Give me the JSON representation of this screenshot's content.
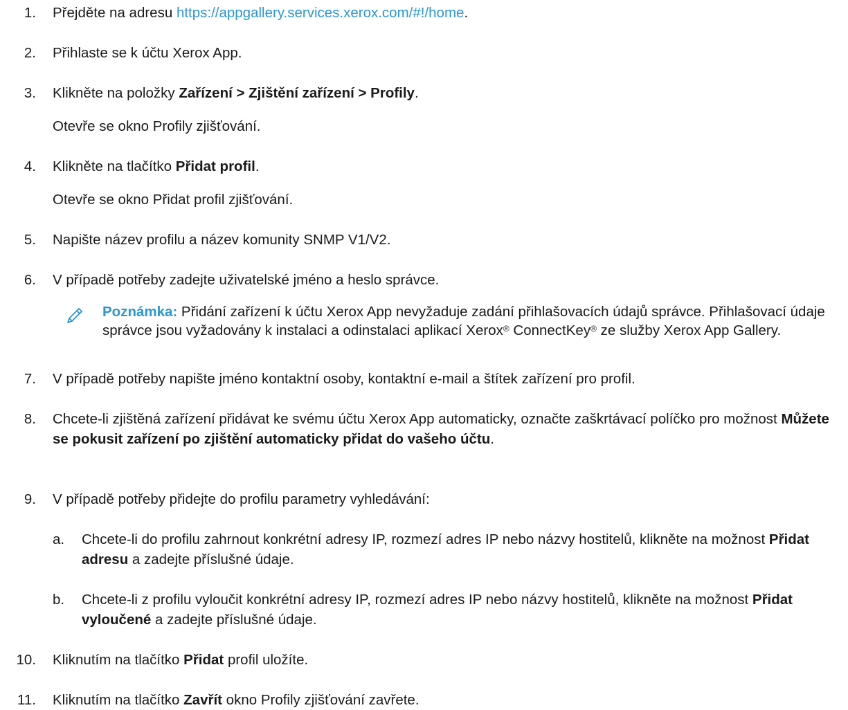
{
  "steps": [
    {
      "num": "1.",
      "text_before": "Přejděte na adresu ",
      "link": "https://appgallery.services.xerox.com/#!/home",
      "text_after": "."
    },
    {
      "num": "2.",
      "text": "Přihlaste se k účtu Xerox App."
    },
    {
      "num": "3.",
      "text_before": "Klikněte na položky ",
      "bold": "Zařízení > Zjištění zařízení > Profily",
      "text_after": ".",
      "result": "Otevře se okno Profily zjišťování."
    },
    {
      "num": "4.",
      "text_before": "Klikněte na tlačítko ",
      "bold": "Přidat profil",
      "text_after": ".",
      "result": "Otevře se okno Přidat profil zjišťování."
    },
    {
      "num": "5.",
      "text": "Napište název profilu a název komunity SNMP V1/V2."
    },
    {
      "num": "6.",
      "text": "V případě potřeby zadejte uživatelské jméno a heslo správce."
    },
    {
      "num": "7.",
      "text": "V případě potřeby napište jméno kontaktní osoby, kontaktní e-mail a štítek zařízení pro profil."
    },
    {
      "num": "8.",
      "text_before": "Chcete-li zjištěná zařízení přidávat ke svému účtu Xerox App automaticky, označte zaškrtávací políčko pro možnost ",
      "bold": "Můžete se pokusit zařízení po zjištění automaticky přidat do vašeho účtu",
      "text_after": "."
    },
    {
      "num": "9.",
      "text": "V případě potřeby přidejte do profilu parametry vyhledávání:"
    },
    {
      "num": "10.",
      "text_before": "Kliknutím na tlačítko ",
      "bold": "Přidat",
      "text_after": " profil uložíte."
    },
    {
      "num": "11.",
      "text_before": "Kliknutím na tlačítko ",
      "bold": "Zavřít",
      "text_after": " okno Profily zjišťování zavřete."
    }
  ],
  "note": {
    "label": "Poznámka:",
    "text_1": " Přidání zařízení k účtu Xerox App nevyžaduje zadání přihlašovacích údajů správce. Přihlašovací údaje správce jsou vyžadovány k instalaci a odinstalaci aplikací Xerox",
    "reg_1": "®",
    "text_2": " ConnectKey",
    "reg_2": "®",
    "text_3": " ze služby Xerox App Gallery.",
    "icon": "pencil-note-icon",
    "label_color": "#2a97d4"
  },
  "substeps": [
    {
      "num": "a.",
      "text_before": "Chcete-li do profilu zahrnout konkrétní adresy IP, rozmezí adres IP nebo názvy hostitelů, klikněte na možnost ",
      "bold": "Přidat adresu",
      "text_after": " a zadejte příslušné údaje."
    },
    {
      "num": "b.",
      "text_before": "Chcete-li z profilu vyloučit konkrétní adresy IP, rozmezí adres IP nebo názvy hostitelů, klikněte na možnost ",
      "bold": "Přidat vyloučené",
      "text_after": " a zadejte příslušné údaje."
    }
  ]
}
